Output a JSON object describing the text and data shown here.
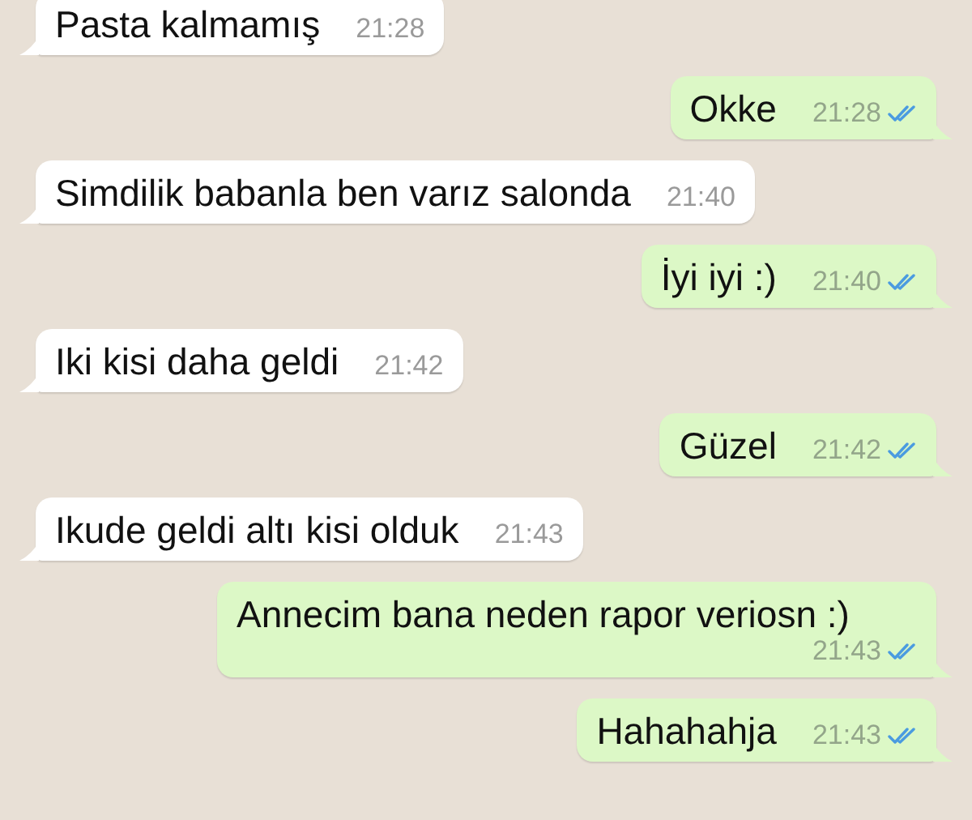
{
  "messages": [
    {
      "kind": "incoming",
      "text": "Pasta kalmamış",
      "time": "21:28"
    },
    {
      "kind": "outgoing",
      "text": "Okke",
      "time": "21:28",
      "read": true
    },
    {
      "kind": "incoming",
      "text": "Simdilik babanla ben varız salonda",
      "time": "21:40"
    },
    {
      "kind": "outgoing",
      "text": "İyi iyi :)",
      "time": "21:40",
      "read": true
    },
    {
      "kind": "incoming",
      "text": "Iki kisi daha geldi",
      "time": "21:42"
    },
    {
      "kind": "outgoing",
      "text": "Güzel",
      "time": "21:42",
      "read": true
    },
    {
      "kind": "incoming",
      "text": "Ikude geldi altı kisi olduk",
      "time": "21:43"
    },
    {
      "kind": "outgoing",
      "text": "Annecim bana neden rapor veriosn :)",
      "time": "21:43",
      "read": true
    },
    {
      "kind": "outgoing",
      "text": "Hahahahja",
      "time": "21:43",
      "read": true
    }
  ]
}
